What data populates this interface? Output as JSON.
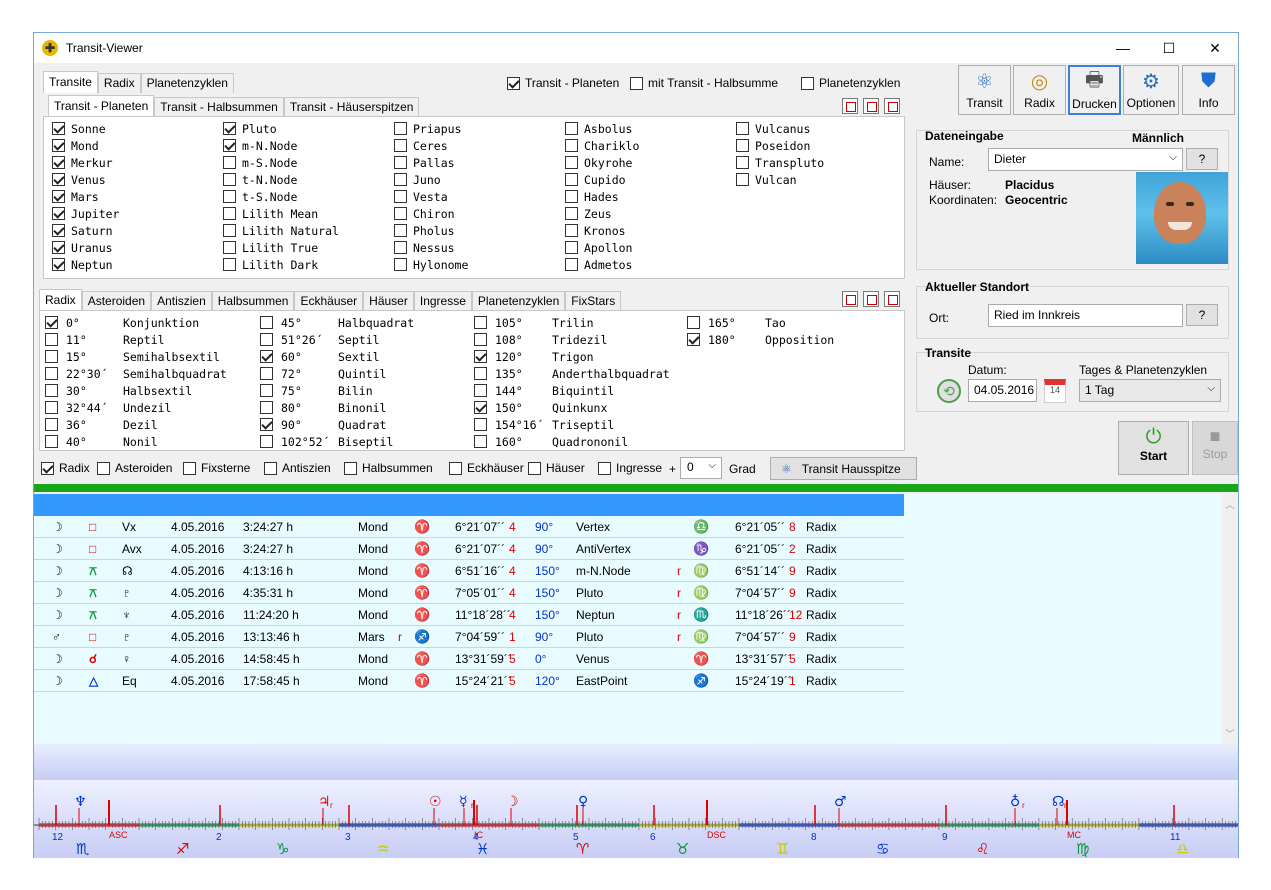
{
  "window": {
    "title": "Transit-Viewer"
  },
  "main_tabs": [
    "Transite",
    "Radix",
    "Planetenzyklen"
  ],
  "top_checks": [
    {
      "label": "Transit - Planeten",
      "on": true
    },
    {
      "label": "mit Transit - Halbsumme",
      "on": false
    },
    {
      "label": "Planetenzyklen",
      "on": false
    }
  ],
  "sub_tabs": [
    "Transit - Planeten",
    "Transit - Halbsummen",
    "Transit - Häuserspitzen"
  ],
  "planets": [
    [
      {
        "l": "Sonne",
        "on": true
      },
      {
        "l": "Mond",
        "on": true
      },
      {
        "l": "Merkur",
        "on": true
      },
      {
        "l": "Venus",
        "on": true
      },
      {
        "l": "Mars",
        "on": true
      },
      {
        "l": "Jupiter",
        "on": true
      },
      {
        "l": "Saturn",
        "on": true
      },
      {
        "l": "Uranus",
        "on": true
      },
      {
        "l": "Neptun",
        "on": true
      }
    ],
    [
      {
        "l": "Pluto",
        "on": true
      },
      {
        "l": "m-N.Node",
        "on": true
      },
      {
        "l": "m-S.Node",
        "on": false
      },
      {
        "l": "t-N.Node",
        "on": false
      },
      {
        "l": "t-S.Node",
        "on": false
      },
      {
        "l": "Lilith Mean",
        "on": false
      },
      {
        "l": "Lilith Natural",
        "on": false
      },
      {
        "l": "Lilith True",
        "on": false
      },
      {
        "l": "Lilith Dark",
        "on": false
      }
    ],
    [
      {
        "l": "Priapus",
        "on": false
      },
      {
        "l": "Ceres",
        "on": false
      },
      {
        "l": "Pallas",
        "on": false
      },
      {
        "l": "Juno",
        "on": false
      },
      {
        "l": "Vesta",
        "on": false
      },
      {
        "l": "Chiron",
        "on": false
      },
      {
        "l": "Pholus",
        "on": false
      },
      {
        "l": "Nessus",
        "on": false
      },
      {
        "l": "Hylonome",
        "on": false
      }
    ],
    [
      {
        "l": "Asbolus",
        "on": false
      },
      {
        "l": "Chariklo",
        "on": false
      },
      {
        "l": "Okyrohe",
        "on": false
      },
      {
        "l": "Cupido",
        "on": false
      },
      {
        "l": "Hades",
        "on": false
      },
      {
        "l": "Zeus",
        "on": false
      },
      {
        "l": "Kronos",
        "on": false
      },
      {
        "l": "Apollon",
        "on": false
      },
      {
        "l": "Admetos",
        "on": false
      }
    ],
    [
      {
        "l": "Vulcanus",
        "on": false
      },
      {
        "l": "Poseidon",
        "on": false
      },
      {
        "l": "Transpluto",
        "on": false
      },
      {
        "l": "Vulcan",
        "on": false
      }
    ]
  ],
  "aspect_tabs": [
    "Radix",
    "Asteroiden",
    "Antiszien",
    "Halbsummen",
    "Eckhäuser",
    "Häuser",
    "Ingresse",
    "Planetenzyklen",
    "FixStars"
  ],
  "aspects": [
    [
      {
        "d": "0°",
        "n": "Konjunktion",
        "on": true
      },
      {
        "d": "11°",
        "n": "Reptil",
        "on": false
      },
      {
        "d": "15°",
        "n": "Semihalbsextil",
        "on": false
      },
      {
        "d": "22°30´",
        "n": "Semihalbquadrat",
        "on": false
      },
      {
        "d": "30°",
        "n": "Halbsextil",
        "on": false
      },
      {
        "d": "32°44´",
        "n": "Undezil",
        "on": false
      },
      {
        "d": "36°",
        "n": "Dezil",
        "on": false
      },
      {
        "d": "40°",
        "n": "Nonil",
        "on": false
      }
    ],
    [
      {
        "d": "45°",
        "n": "Halbquadrat",
        "on": false
      },
      {
        "d": "51°26´",
        "n": "Septil",
        "on": false
      },
      {
        "d": "60°",
        "n": "Sextil",
        "on": true
      },
      {
        "d": "72°",
        "n": "Quintil",
        "on": false
      },
      {
        "d": "75°",
        "n": "Bilin",
        "on": false
      },
      {
        "d": "80°",
        "n": "Binonil",
        "on": false
      },
      {
        "d": "90°",
        "n": "Quadrat",
        "on": true
      },
      {
        "d": "102°52´",
        "n": "Biseptil",
        "on": false
      }
    ],
    [
      {
        "d": "105°",
        "n": "Trilin",
        "on": false
      },
      {
        "d": "108°",
        "n": "Tridezil",
        "on": false
      },
      {
        "d": "120°",
        "n": "Trigon",
        "on": true
      },
      {
        "d": "135°",
        "n": "Anderthalbquadrat",
        "on": false
      },
      {
        "d": "144°",
        "n": "Biquintil",
        "on": false
      },
      {
        "d": "150°",
        "n": "Quinkunx",
        "on": true
      },
      {
        "d": "154°16´",
        "n": "Triseptil",
        "on": false
      },
      {
        "d": "160°",
        "n": "Quadrononil",
        "on": false
      }
    ],
    [
      {
        "d": "165°",
        "n": "Tao",
        "on": false
      },
      {
        "d": "180°",
        "n": "Opposition",
        "on": true
      }
    ]
  ],
  "bottom_checks": [
    {
      "label": "Radix",
      "on": true
    },
    {
      "label": "Asteroiden",
      "on": false
    },
    {
      "label": "Fixsterne",
      "on": false
    },
    {
      "label": "Antiszien",
      "on": false
    },
    {
      "label": "Halbsummen",
      "on": false
    },
    {
      "label": "Eckhäuser",
      "on": false
    },
    {
      "label": "Häuser",
      "on": false
    },
    {
      "label": "Ingresse",
      "on": false
    }
  ],
  "plus": "+",
  "grad_value": "0",
  "grad_label": "Grad",
  "hausspitze_button": "Transit Hausspitze",
  "toolbar": [
    "Transit",
    "Radix",
    "Drucken",
    "Optionen",
    "Info"
  ],
  "data_input": {
    "title": "Dateneingabe",
    "gender": "Männlich",
    "name_label": "Name:",
    "name_value": "Dieter",
    "q": "?",
    "houses_label": "Häuser:",
    "houses_value": "Placidus",
    "coords_label": "Koordinaten:",
    "coords_value": "Geocentric"
  },
  "location": {
    "title": "Aktueller Standort",
    "ort_label": "Ort:",
    "ort_value": "Ried im Innkreis",
    "q": "?"
  },
  "transite": {
    "title": "Transite",
    "datum_label": "Datum:",
    "datum_value": "04.05.2016",
    "cal_day": "14",
    "cycles_label": "Tages & Planetenzyklen",
    "cycles_value": "1 Tag"
  },
  "actions": {
    "start": "Start",
    "stop": "Stop"
  },
  "rows": [
    {
      "a": "☽",
      "asp": "□",
      "t": "Vx",
      "date": "4.05.2016",
      "time": "3:24:27 h",
      "p": "Mond",
      "r": "",
      "sign": "♈",
      "pos": "6°21´07´´",
      "h": "4",
      "deg": "90°",
      "name": "Vertex",
      "r2": "",
      "sign2": "♎",
      "pos2": "6°21´05´´",
      "h2": "8",
      "src": "Radix"
    },
    {
      "a": "☽",
      "asp": "□",
      "t": "Avx",
      "date": "4.05.2016",
      "time": "3:24:27 h",
      "p": "Mond",
      "r": "",
      "sign": "♈",
      "pos": "6°21´07´´",
      "h": "4",
      "deg": "90°",
      "name": "AntiVertex",
      "r2": "",
      "sign2": "♑",
      "pos2": "6°21´05´´",
      "h2": "2",
      "src": "Radix"
    },
    {
      "a": "☽",
      "asp": "⚻",
      "t": "☊",
      "date": "4.05.2016",
      "time": "4:13:16 h",
      "p": "Mond",
      "r": "",
      "sign": "♈",
      "pos": "6°51´16´´",
      "h": "4",
      "deg": "150°",
      "name": "m-N.Node",
      "r2": "r",
      "sign2": "♍",
      "pos2": "6°51´14´´",
      "h2": "9",
      "src": "Radix"
    },
    {
      "a": "☽",
      "asp": "⚻",
      "t": "♇",
      "date": "4.05.2016",
      "time": "4:35:31 h",
      "p": "Mond",
      "r": "",
      "sign": "♈",
      "pos": "7°05´01´´",
      "h": "4",
      "deg": "150°",
      "name": "Pluto",
      "r2": "r",
      "sign2": "♍",
      "pos2": "7°04´57´´",
      "h2": "9",
      "src": "Radix"
    },
    {
      "a": "☽",
      "asp": "⚻",
      "t": "♆",
      "date": "4.05.2016",
      "time": "11:24:20 h",
      "p": "Mond",
      "r": "",
      "sign": "♈",
      "pos": "11°18´28´´",
      "h": "4",
      "deg": "150°",
      "name": "Neptun",
      "r2": "r",
      "sign2": "♏",
      "pos2": "11°18´26´´",
      "h2": "12",
      "src": "Radix"
    },
    {
      "a": "♂",
      "asp": "□",
      "t": "♇",
      "date": "4.05.2016",
      "time": "13:13:46 h",
      "p": "Mars",
      "r": "r",
      "sign": "♐",
      "pos": "7°04´59´´",
      "h": "1",
      "deg": "90°",
      "name": "Pluto",
      "r2": "r",
      "sign2": "♍",
      "pos2": "7°04´57´´",
      "h2": "9",
      "src": "Radix"
    },
    {
      "a": "☽",
      "asp": "☌",
      "t": "♀",
      "date": "4.05.2016",
      "time": "14:58:45 h",
      "p": "Mond",
      "r": "",
      "sign": "♈",
      "pos": "13°31´59´´",
      "h": "5",
      "deg": "0°",
      "name": "Venus",
      "r2": "",
      "sign2": "♈",
      "pos2": "13°31´57´´",
      "h2": "5",
      "src": "Radix"
    },
    {
      "a": "☽",
      "asp": "△",
      "t": "Eq",
      "date": "4.05.2016",
      "time": "17:58:45 h",
      "p": "Mond",
      "r": "",
      "sign": "♈",
      "pos": "15°24´21´´",
      "h": "5",
      "deg": "120°",
      "name": "EastPoint",
      "r2": "",
      "sign2": "♐",
      "pos2": "15°24´19´´",
      "h2": "1",
      "src": "Radix"
    }
  ],
  "ruler": {
    "houses": [
      "12",
      "2",
      "3",
      "4",
      "5",
      "6",
      "8",
      "9",
      "11"
    ],
    "angles": [
      "ASC",
      "IC",
      "DSC",
      "MC"
    ],
    "signs": [
      "♏",
      "♐",
      "♑",
      "♒",
      "♓",
      "♈",
      "♉",
      "♊",
      "♋",
      "♌",
      "♍",
      "♎"
    ],
    "planets": [
      "♆",
      "♃",
      "☉",
      "☿",
      "☽",
      "♀",
      "♂",
      "♁",
      "☊"
    ],
    "retro": "r"
  }
}
